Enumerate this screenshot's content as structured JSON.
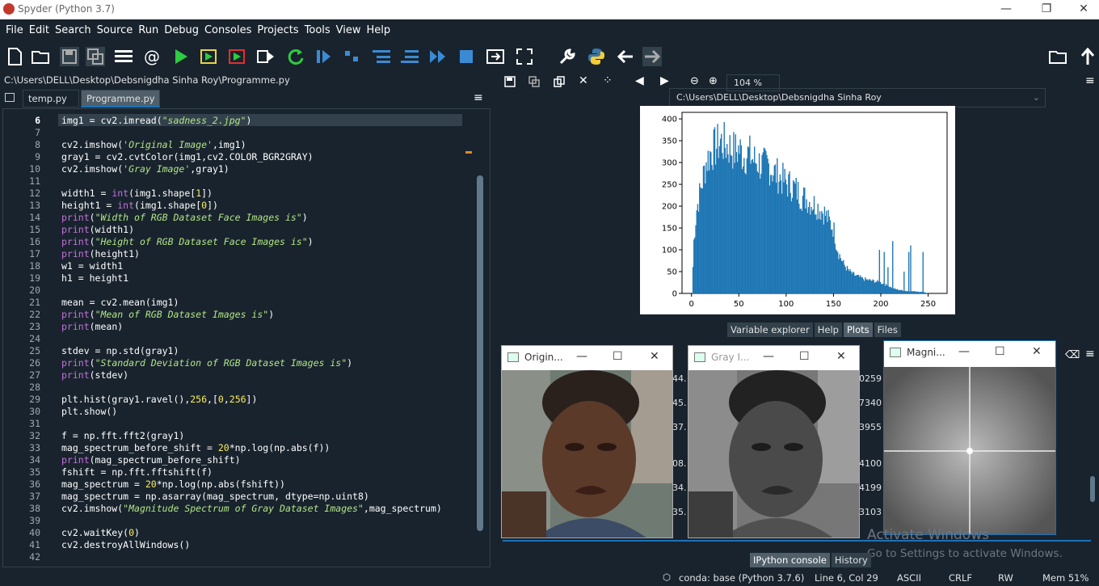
{
  "window": {
    "title": "Spyder (Python 3.7)",
    "minimize": "—",
    "maximize": "❐",
    "close": "✕"
  },
  "menu": [
    "File",
    "Edit",
    "Search",
    "Source",
    "Run",
    "Debug",
    "Consoles",
    "Projects",
    "Tools",
    "View",
    "Help"
  ],
  "toolbar": {
    "path": "C:\\Users\\DELL\\Desktop\\Debsnigdha Sinha Roy"
  },
  "editor": {
    "file_path": "C:\\Users\\DELL\\Desktop\\Debsnigdha Sinha Roy\\Programme.py",
    "tabs": [
      {
        "label": "temp.py"
      },
      {
        "label": "Programme.py"
      }
    ],
    "line_numbers": [
      "6",
      "7",
      "8",
      "9",
      "10",
      "11",
      "12",
      "13",
      "14",
      "15",
      "16",
      "17",
      "18",
      "19",
      "20",
      "21",
      "22",
      "23",
      "24",
      "25",
      "26",
      "27",
      "28",
      "29",
      "30",
      "31",
      "32",
      "33",
      "34",
      "35",
      "36",
      "37",
      "38",
      "39",
      "40",
      "41",
      "42"
    ]
  },
  "plots": {
    "zoom": "104 %",
    "tabs": [
      "Variable explorer",
      "Help",
      "Plots",
      "Files"
    ],
    "active_tab": "Plots"
  },
  "chart_data": {
    "type": "bar",
    "title": "",
    "xlabel": "",
    "ylabel": "",
    "xlim": [
      -10,
      270
    ],
    "ylim": [
      0,
      415
    ],
    "xticks": [
      "0",
      "50",
      "100",
      "150",
      "200",
      "250"
    ],
    "yticks": [
      "0",
      "50",
      "100",
      "150",
      "200",
      "250",
      "300",
      "350",
      "400"
    ],
    "grid": false,
    "color": "#1f77b4",
    "bins": 256,
    "envelope_x": [
      0,
      2,
      5,
      10,
      15,
      20,
      25,
      30,
      35,
      40,
      45,
      50,
      55,
      60,
      65,
      70,
      75,
      80,
      85,
      90,
      95,
      100,
      105,
      110,
      115,
      120,
      125,
      130,
      135,
      140,
      145,
      150,
      152,
      155,
      160,
      165,
      170,
      175,
      180,
      185,
      190,
      195,
      200,
      205,
      210,
      215,
      220,
      225,
      230,
      235,
      240,
      245,
      250,
      255
    ],
    "envelope_y": [
      0,
      125,
      200,
      255,
      310,
      335,
      345,
      360,
      350,
      345,
      335,
      340,
      325,
      330,
      315,
      310,
      300,
      305,
      290,
      280,
      270,
      260,
      255,
      245,
      230,
      225,
      215,
      210,
      200,
      190,
      170,
      150,
      120,
      95,
      70,
      55,
      45,
      40,
      35,
      32,
      30,
      28,
      25,
      20,
      15,
      10,
      8,
      6,
      5,
      5,
      4,
      3,
      0,
      0
    ],
    "spikes": [
      [
        198,
        100
      ],
      [
        203,
        95
      ],
      [
        207,
        60
      ],
      [
        212,
        120
      ],
      [
        224,
        50
      ],
      [
        229,
        95
      ],
      [
        231,
        110
      ],
      [
        244,
        95
      ]
    ]
  },
  "windows": {
    "w1": {
      "title": "Origin...",
      "min": "—",
      "max": "☐",
      "close": "✕"
    },
    "w2": {
      "title": "Gray I...",
      "min": "—",
      "max": "☐",
      "close": "✕"
    },
    "w3": {
      "title": "Magni...",
      "min": "—",
      "max": "☐",
      "close": "✕"
    }
  },
  "console_partial_left": [
    "44.",
    "45.",
    "37.",
    "08.",
    "34.",
    "35."
  ],
  "console_partial_right": [
    "0259",
    "7340",
    "3955",
    "4100",
    "4199",
    "3103"
  ],
  "console_tabs": [
    "IPython console",
    "History"
  ],
  "watermark": {
    "line1": "Activate Windows",
    "line2": "Go to Settings to activate Windows."
  },
  "status": {
    "env": "conda: base (Python 3.7.6)",
    "pos": "Line 6, Col 29",
    "enc": "ASCII",
    "eol": "CRLF",
    "perm": "RW",
    "mem": "Mem 51%"
  }
}
